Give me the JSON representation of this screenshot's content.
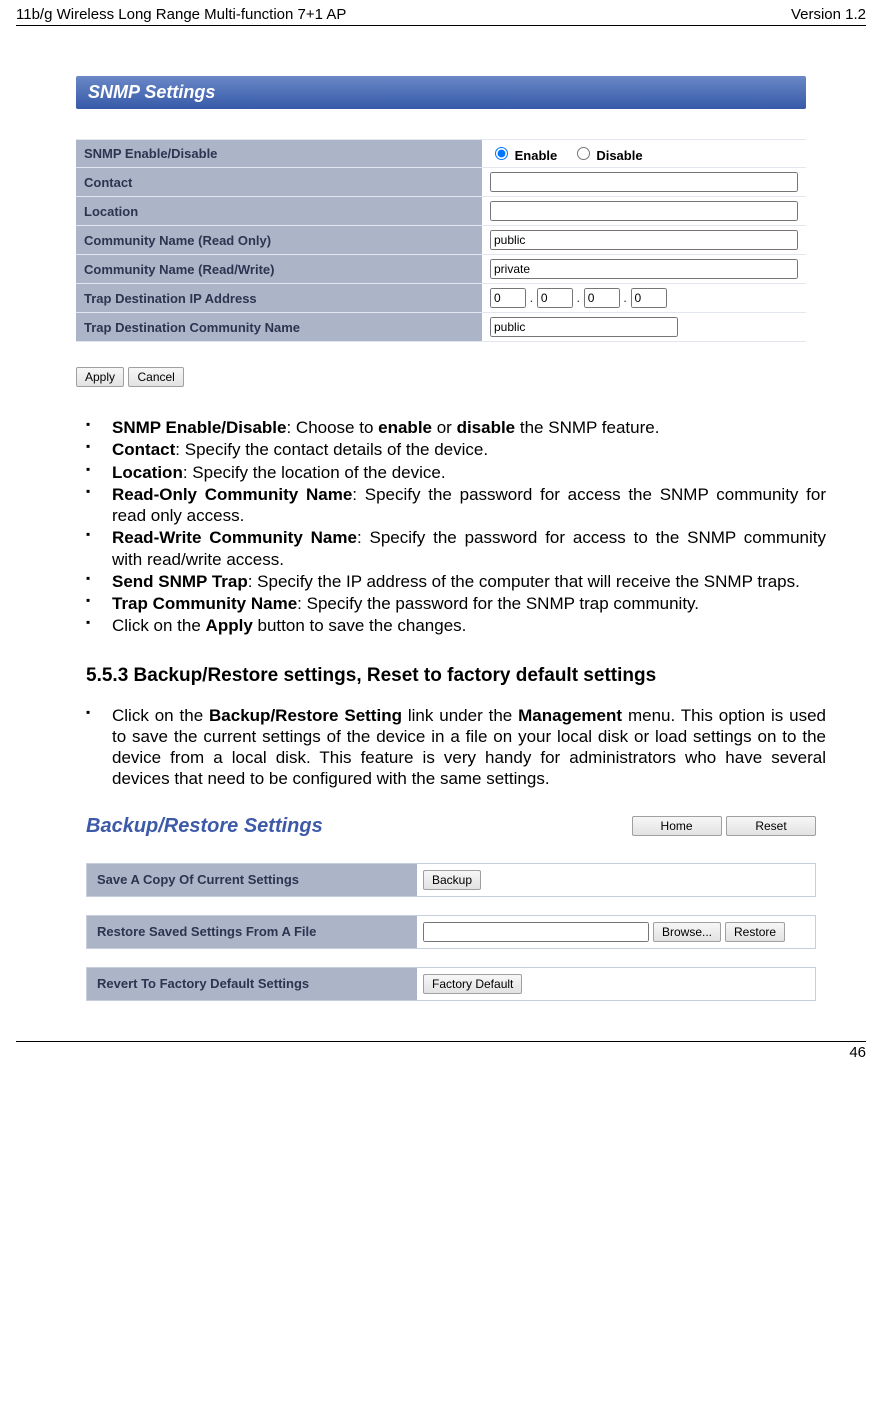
{
  "header": {
    "left": "11b/g Wireless Long Range Multi-function 7+1 AP",
    "right": "Version 1.2"
  },
  "snmp": {
    "title": "SNMP Settings",
    "rows": {
      "enable_label": "SNMP Enable/Disable",
      "enable_opt": "Enable",
      "disable_opt": "Disable",
      "contact_label": "Contact",
      "contact_val": "",
      "location_label": "Location",
      "location_val": "",
      "ro_label": "Community Name (Read Only)",
      "ro_val": "public",
      "rw_label": "Community Name (Read/Write)",
      "rw_val": "private",
      "trapip_label": "Trap Destination IP Address",
      "ip1": "0",
      "ip2": "0",
      "ip3": "0",
      "ip4": "0",
      "trapcn_label": "Trap Destination Community Name",
      "trapcn_val": "public"
    },
    "apply": "Apply",
    "cancel": "Cancel"
  },
  "bullets1": {
    "b1_bold": "SNMP Enable/Disable",
    "b1_plain_a": ": Choose to ",
    "b1_bold_b": "enable",
    "b1_plain_b": " or ",
    "b1_bold_c": "disable",
    "b1_plain_c": " the SNMP feature.",
    "b2_bold": "Contact",
    "b2_plain": ": Specify the contact details of the device.",
    "b3_bold": "Location",
    "b3_plain": ": Specify the location of the device.",
    "b4_bold": "Read-Only Community Name",
    "b4_plain": ": Specify the password for access the SNMP community for read only access.",
    "b5_bold": "Read-Write Community Name",
    "b5_plain": ": Specify the password for access to the SNMP community with read/write access.",
    "b6_bold": "Send SNMP Trap",
    "b6_plain": ": Specify the IP address of the computer that will receive the SNMP traps.",
    "b7_bold": "Trap Community Name",
    "b7_plain": ": Specify the password for the SNMP trap community.",
    "b8_a": "Click on the ",
    "b8_bold": "Apply",
    "b8_b": " button to save the changes."
  },
  "section": "5.5.3   Backup/Restore settings, Reset to factory default settings",
  "bullets2": {
    "a": "Click on the ",
    "bold1": "Backup/Restore Setting",
    "b": " link under the ",
    "bold2": "Management",
    "c": " menu. This option is used to save the current settings of the device in a file on your local disk or load settings on to the device from a local disk. This feature is very handy for administrators who have several devices that need to be configured with the same settings."
  },
  "backup": {
    "title": "Backup/Restore Settings",
    "home": "Home",
    "reset": "Reset",
    "row1_label": "Save A Copy Of Current Settings",
    "row1_btn": "Backup",
    "row2_label": "Restore Saved Settings From A File",
    "row2_browse": "Browse...",
    "row2_restore": "Restore",
    "row3_label": "Revert To Factory Default Settings",
    "row3_btn": "Factory Default"
  },
  "footer": "46"
}
